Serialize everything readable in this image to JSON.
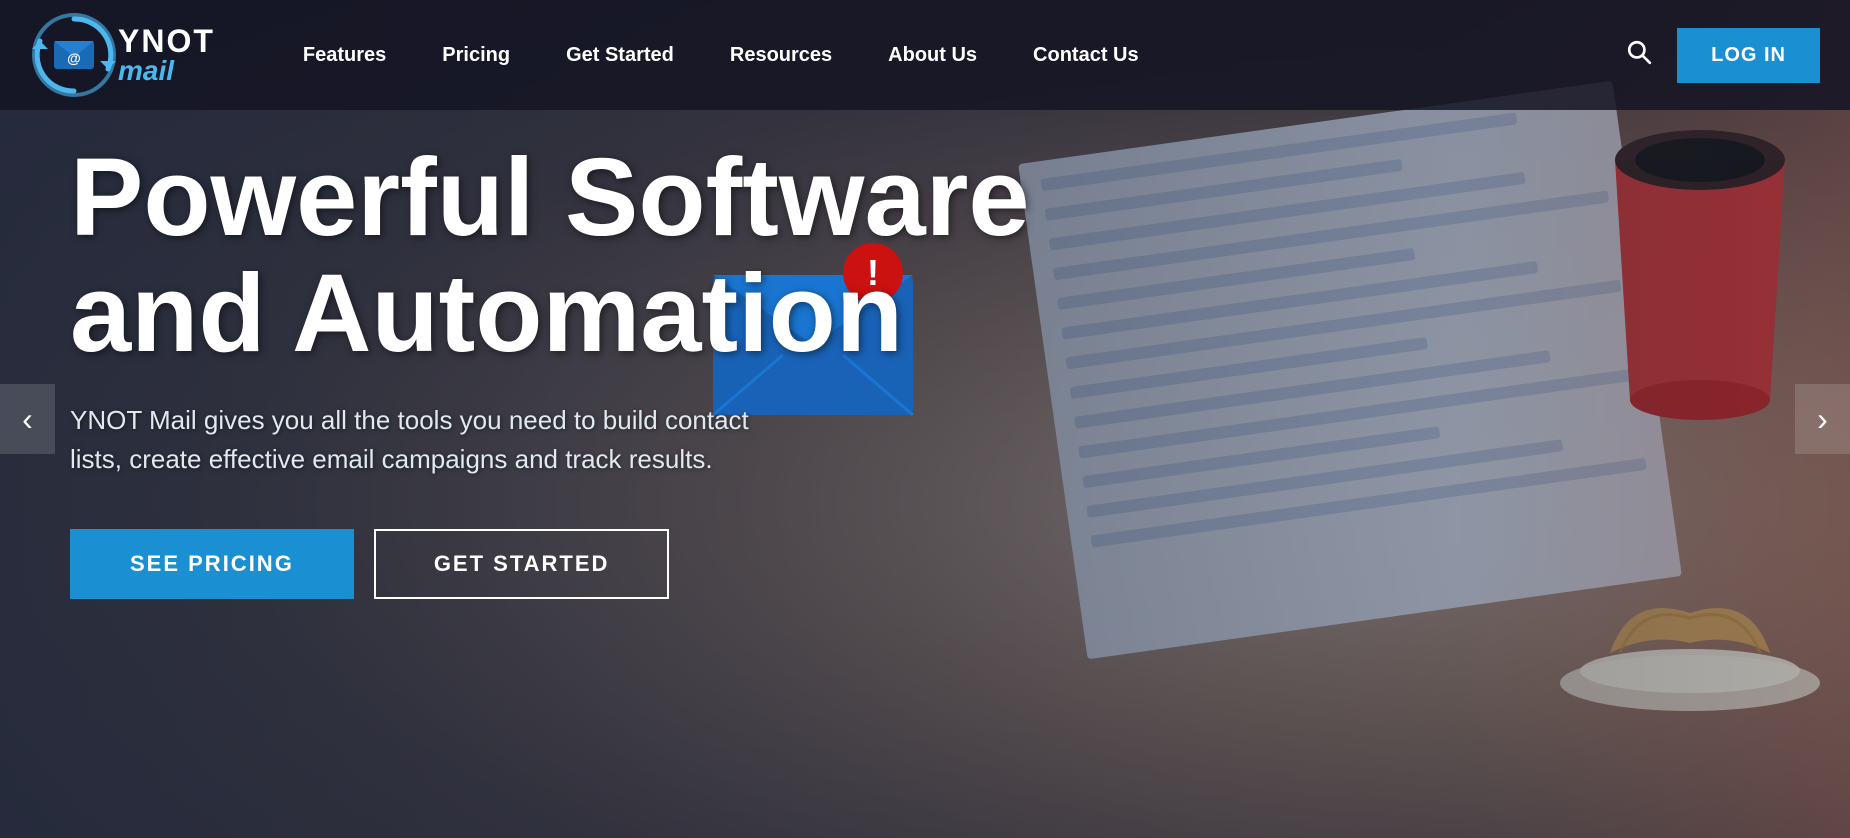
{
  "header": {
    "logo": {
      "ynot": "YNOT",
      "mail": "mail"
    },
    "nav": {
      "items": [
        {
          "label": "Features",
          "id": "features"
        },
        {
          "label": "Pricing",
          "id": "pricing"
        },
        {
          "label": "Get Started",
          "id": "get-started"
        },
        {
          "label": "Resources",
          "id": "resources"
        },
        {
          "label": "About Us",
          "id": "about-us"
        },
        {
          "label": "Contact Us",
          "id": "contact-us"
        }
      ]
    },
    "login_label": "LOG IN"
  },
  "hero": {
    "title_line1": "Powerful Software",
    "title_line2": "and Automation",
    "subtitle": "YNOT Mail gives you all the tools you need to build contact lists, create effective email campaigns and track results.",
    "cta_primary": "SEE PRICING",
    "cta_secondary": "GET STARTED"
  },
  "carousel": {
    "prev_label": "‹",
    "next_label": "›"
  }
}
